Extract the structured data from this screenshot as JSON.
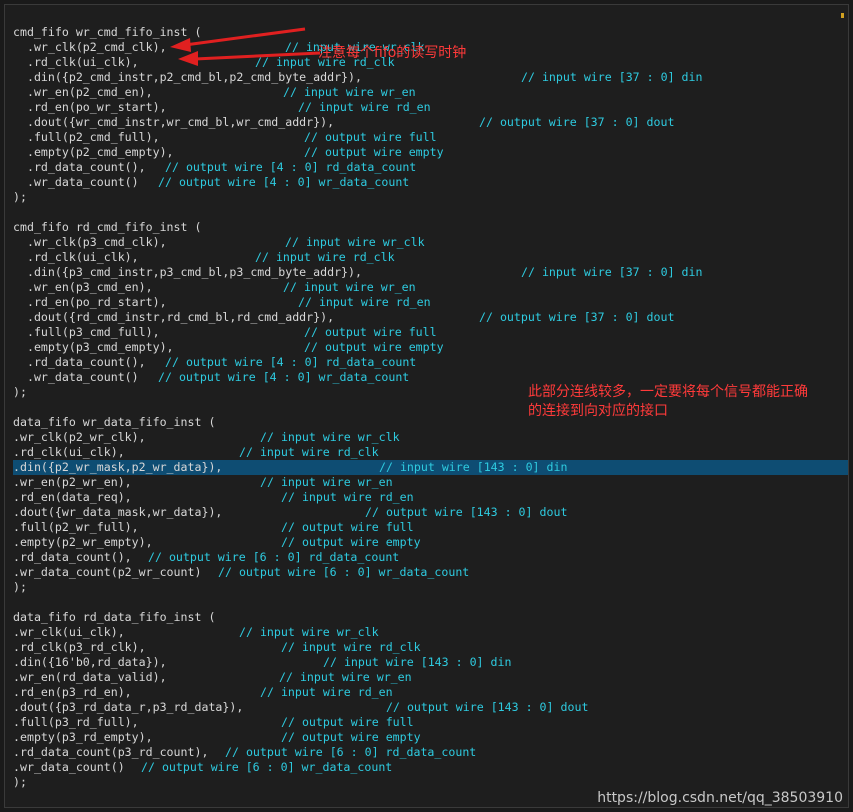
{
  "annotations": {
    "clock_note": "注意每个fifo的读写时钟",
    "signal_note_1": "此部分连线较多，一定要将每个信号都能正确",
    "signal_note_2": "的连接到向对应的接口"
  },
  "watermark": "https://blog.csdn.net/qq_38503910",
  "colors": {
    "code": "#d7d7d7",
    "comment": "#2ecbe0",
    "highlight": "#0e4d73",
    "annotation": "#ff3a3a"
  },
  "lines": [
    {
      "code": "cmd_fifo wr_cmd_fifo_inst (",
      "comment": ""
    },
    {
      "code": "  .wr_clk(p2_cmd_clk),",
      "comment": "// input wire wr_clk"
    },
    {
      "code": "  .rd_clk(ui_clk),",
      "comment": "// input wire rd_clk"
    },
    {
      "code": "  .din({p2_cmd_instr,p2_cmd_bl,p2_cmd_byte_addr}),",
      "comment": "// input wire [37 : 0] din"
    },
    {
      "code": "  .wr_en(p2_cmd_en),",
      "comment": "// input wire wr_en"
    },
    {
      "code": "  .rd_en(po_wr_start),",
      "comment": "// input wire rd_en"
    },
    {
      "code": "  .dout({wr_cmd_instr,wr_cmd_bl,wr_cmd_addr}),",
      "comment": "// output wire [37 : 0] dout"
    },
    {
      "code": "  .full(p2_cmd_full),",
      "comment": "// output wire full"
    },
    {
      "code": "  .empty(p2_cmd_empty),",
      "comment": "// output wire empty"
    },
    {
      "code": "  .rd_data_count(),",
      "comment": "// output wire [4 : 0] rd_data_count"
    },
    {
      "code": "  .wr_data_count()",
      "comment": "// output wire [4 : 0] wr_data_count"
    },
    {
      "code": ");",
      "comment": ""
    },
    {
      "code": "",
      "comment": ""
    },
    {
      "code": "cmd_fifo rd_cmd_fifo_inst (",
      "comment": ""
    },
    {
      "code": "  .wr_clk(p3_cmd_clk),",
      "comment": "// input wire wr_clk"
    },
    {
      "code": "  .rd_clk(ui_clk),",
      "comment": "// input wire rd_clk"
    },
    {
      "code": "  .din({p3_cmd_instr,p3_cmd_bl,p3_cmd_byte_addr}),",
      "comment": "// input wire [37 : 0] din"
    },
    {
      "code": "  .wr_en(p3_cmd_en),",
      "comment": "// input wire wr_en"
    },
    {
      "code": "  .rd_en(po_rd_start),",
      "comment": "// input wire rd_en"
    },
    {
      "code": "  .dout({rd_cmd_instr,rd_cmd_bl,rd_cmd_addr}),",
      "comment": "// output wire [37 : 0] dout"
    },
    {
      "code": "  .full(p3_cmd_full),",
      "comment": "// output wire full"
    },
    {
      "code": "  .empty(p3_cmd_empty),",
      "comment": "// output wire empty"
    },
    {
      "code": "  .rd_data_count(),",
      "comment": "// output wire [4 : 0] rd_data_count"
    },
    {
      "code": "  .wr_data_count()",
      "comment": "// output wire [4 : 0] wr_data_count"
    },
    {
      "code": ");",
      "comment": ""
    },
    {
      "code": "",
      "comment": ""
    },
    {
      "code": "data_fifo wr_data_fifo_inst (",
      "comment": ""
    },
    {
      "code": ".wr_clk(p2_wr_clk),",
      "comment": "// input wire wr_clk"
    },
    {
      "code": ".rd_clk(ui_clk),",
      "comment": "// input wire rd_clk"
    },
    {
      "code": ".din({p2_wr_mask,p2_wr_data}),",
      "comment": "// input wire [143 : 0] din"
    },
    {
      "code": ".wr_en(p2_wr_en),",
      "comment": "// input wire wr_en"
    },
    {
      "code": ".rd_en(data_req),",
      "comment": "// input wire rd_en"
    },
    {
      "code": ".dout({wr_data_mask,wr_data}),",
      "comment": "// output wire [143 : 0] dout"
    },
    {
      "code": ".full(p2_wr_full),",
      "comment": "// output wire full"
    },
    {
      "code": ".empty(p2_wr_empty),",
      "comment": "// output wire empty"
    },
    {
      "code": ".rd_data_count(),",
      "comment": "// output wire [6 : 0] rd_data_count"
    },
    {
      "code": ".wr_data_count(p2_wr_count)",
      "comment": "// output wire [6 : 0] wr_data_count"
    },
    {
      "code": ");",
      "comment": ""
    },
    {
      "code": "",
      "comment": ""
    },
    {
      "code": "data_fifo rd_data_fifo_inst (",
      "comment": ""
    },
    {
      "code": ".wr_clk(ui_clk),",
      "comment": "// input wire wr_clk"
    },
    {
      "code": ".rd_clk(p3_rd_clk),",
      "comment": "// input wire rd_clk"
    },
    {
      "code": ".din({16'b0,rd_data}),",
      "comment": "// input wire [143 : 0] din"
    },
    {
      "code": ".wr_en(rd_data_valid),",
      "comment": "// input wire wr_en"
    },
    {
      "code": ".rd_en(p3_rd_en),",
      "comment": "// input wire rd_en"
    },
    {
      "code": ".dout({p3_rd_data_r,p3_rd_data}),",
      "comment": "// output wire [143 : 0] dout"
    },
    {
      "code": ".full(p3_rd_full),",
      "comment": "// output wire full"
    },
    {
      "code": ".empty(p3_rd_empty),",
      "comment": "// output wire empty"
    },
    {
      "code": ".rd_data_count(p3_rd_count),",
      "comment": "// output wire [6 : 0] rd_data_count"
    },
    {
      "code": ".wr_data_count()",
      "comment": "// output wire [6 : 0] wr_data_count"
    },
    {
      "code": ");",
      "comment": ""
    }
  ]
}
